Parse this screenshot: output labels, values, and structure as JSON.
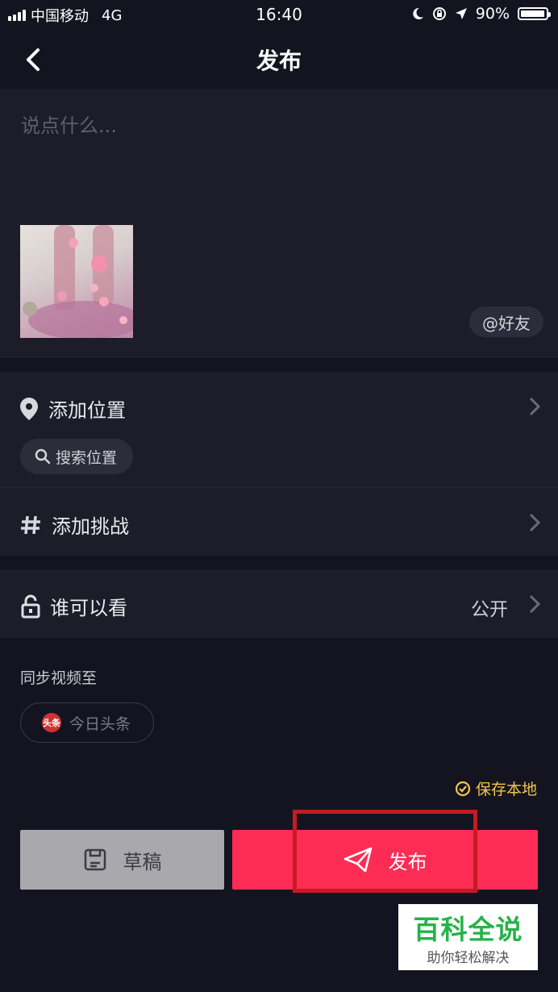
{
  "status_bar": {
    "carrier": "中国移动",
    "network": "4G",
    "time": "16:40",
    "battery": "90%",
    "battery_level": 0.9
  },
  "nav": {
    "title": "发布",
    "back_icon": "chevron-left-icon"
  },
  "caption": {
    "placeholder": "说点什么...",
    "friends_label": "@好友"
  },
  "location": {
    "label": "添加位置",
    "search_label": "搜索位置"
  },
  "challenge": {
    "label": "添加挑战"
  },
  "visibility": {
    "label": "谁可以看",
    "value": "公开"
  },
  "sync": {
    "title": "同步视频至",
    "toutiao_label": "今日头条",
    "toutiao_logo_text": "头条"
  },
  "save_local": {
    "label": "保存本地"
  },
  "buttons": {
    "draft": "草稿",
    "publish": "发布"
  },
  "colors": {
    "publish": "#fd2c55",
    "draft": "#a9a8ad",
    "highlight": "#c41b23",
    "save_local": "#f4c74a",
    "watermark_green": "#27b24a"
  },
  "watermark": {
    "title": "百科全说",
    "subtitle": "助你轻松解决"
  }
}
